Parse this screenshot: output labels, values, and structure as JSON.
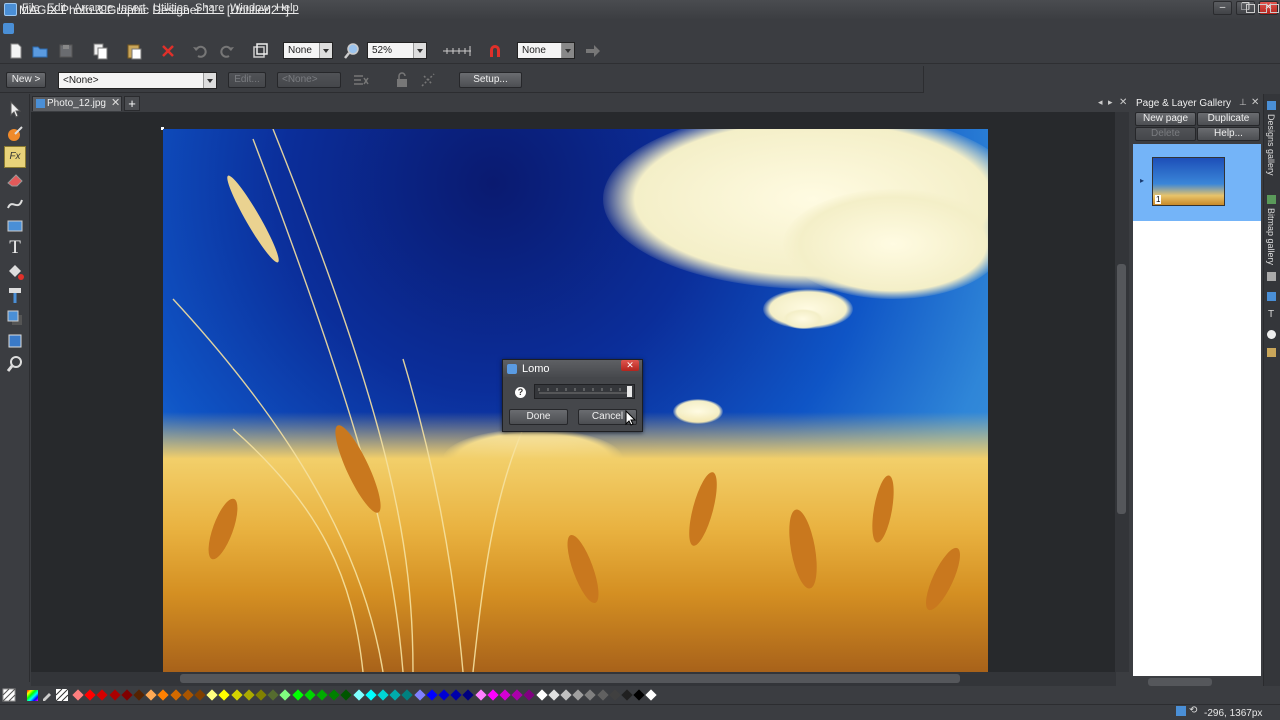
{
  "window": {
    "title": "MAGIX Photo & Graphic Designer 11 - [Untitled2 *]",
    "min_label": "–",
    "max_label": "❐",
    "close_label": "✕"
  },
  "menu": {
    "items": [
      "File",
      "Edit",
      "Arrange",
      "Insert",
      "Utilities",
      "Share",
      "Window",
      "Help"
    ]
  },
  "toolbar1": {
    "quality_value": "None",
    "zoom_value": "52%",
    "snap_value": "None"
  },
  "toolbar2": {
    "new_label": "New >",
    "preset_value": "<None>",
    "edit_label": "Edit...",
    "none2_value": "<None>",
    "setup_label": "Setup..."
  },
  "document": {
    "tab_label": "Photo_12.jpg",
    "tab_close": "✕",
    "add_tab": "+"
  },
  "dialog": {
    "title": "Lomo",
    "close": "✕",
    "help": "?",
    "slider_value": 1.0,
    "done_label": "Done",
    "cancel_label": "Cancel"
  },
  "right_panel": {
    "title": "Page & Layer Gallery",
    "new_page_label": "New page",
    "duplicate_label": "Duplicate",
    "delete_label": "Delete",
    "help_label": "Help...",
    "page_number": "1"
  },
  "side_tabs": [
    "Designs gallery",
    "Bitmap gallery"
  ],
  "palette": {
    "colors": [
      "#ff7f7f",
      "#ff0000",
      "#d40000",
      "#aa0000",
      "#800000",
      "#552200",
      "#ffaa55",
      "#ff8000",
      "#d46a00",
      "#aa5500",
      "#803f00",
      "#ffff80",
      "#ffff00",
      "#d4d400",
      "#aaaa00",
      "#808000",
      "#556b2f",
      "#80ff80",
      "#00ff00",
      "#00d400",
      "#00aa00",
      "#008000",
      "#005500",
      "#80ffff",
      "#00ffff",
      "#00d4d4",
      "#00aaaa",
      "#008080",
      "#8080ff",
      "#0000ff",
      "#0000d4",
      "#0000aa",
      "#000080",
      "#ff80ff",
      "#ff00ff",
      "#d400d4",
      "#aa00aa",
      "#800080",
      "#ffffff",
      "#e0e0e0",
      "#c0c0c0",
      "#a0a0a0",
      "#808080",
      "#606060",
      "#404040",
      "#202020",
      "#000000",
      "#ffffff"
    ]
  },
  "status": {
    "coords": "-296, 1367px"
  }
}
